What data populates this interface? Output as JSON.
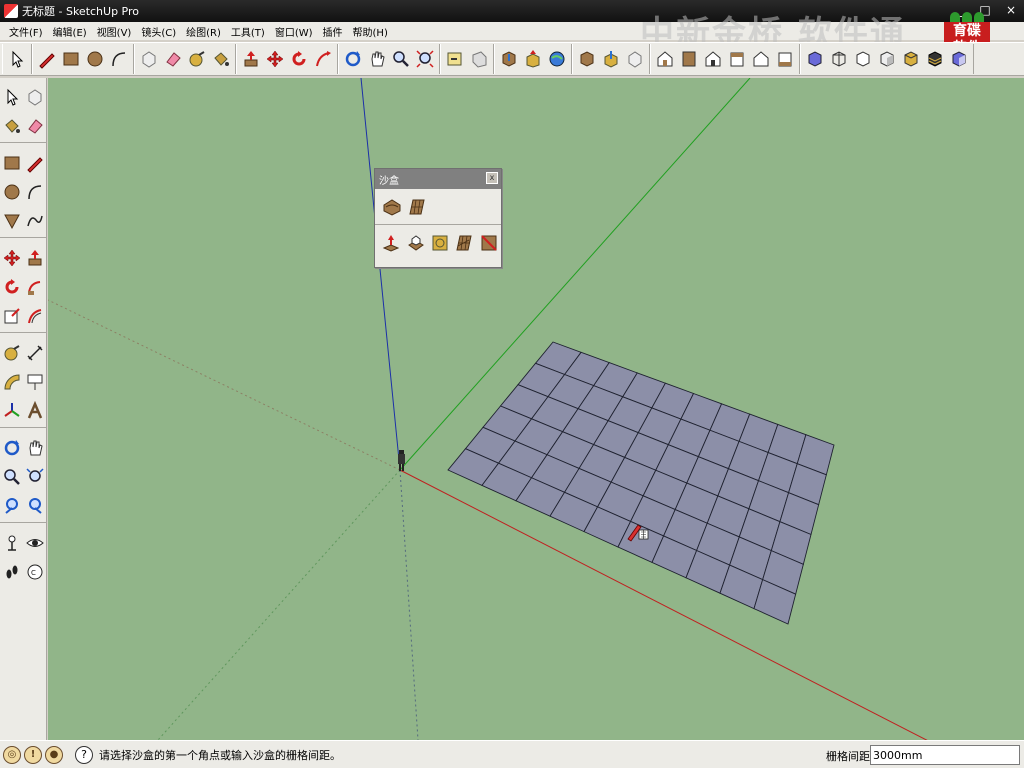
{
  "window": {
    "title": "无标题 - SketchUp Pro",
    "minimize": "_",
    "restore": "□",
    "close": "×"
  },
  "watermark": "中新金桥 软件通",
  "logo": {
    "text": "育碟\n软件"
  },
  "menu": [
    "文件(F)",
    "编辑(E)",
    "视图(V)",
    "镜头(C)",
    "绘图(R)",
    "工具(T)",
    "窗口(W)",
    "插件",
    "帮助(H)"
  ],
  "sandbox_toolbar": {
    "title": "沙盒",
    "close": "x"
  },
  "status": {
    "message": "请选择沙盒的第一个角点或输入沙盒的栅格间距。",
    "measurement_label": "栅格间距",
    "measurement_value": "3000mm",
    "help": "?"
  },
  "colors": {
    "viewport_bg": "#91b589",
    "grid_fill": "#8c8fa8",
    "grid_line": "#1f2230",
    "axis_red": "#c02020",
    "axis_green": "#20a020",
    "axis_blue": "#1b2fa8"
  }
}
